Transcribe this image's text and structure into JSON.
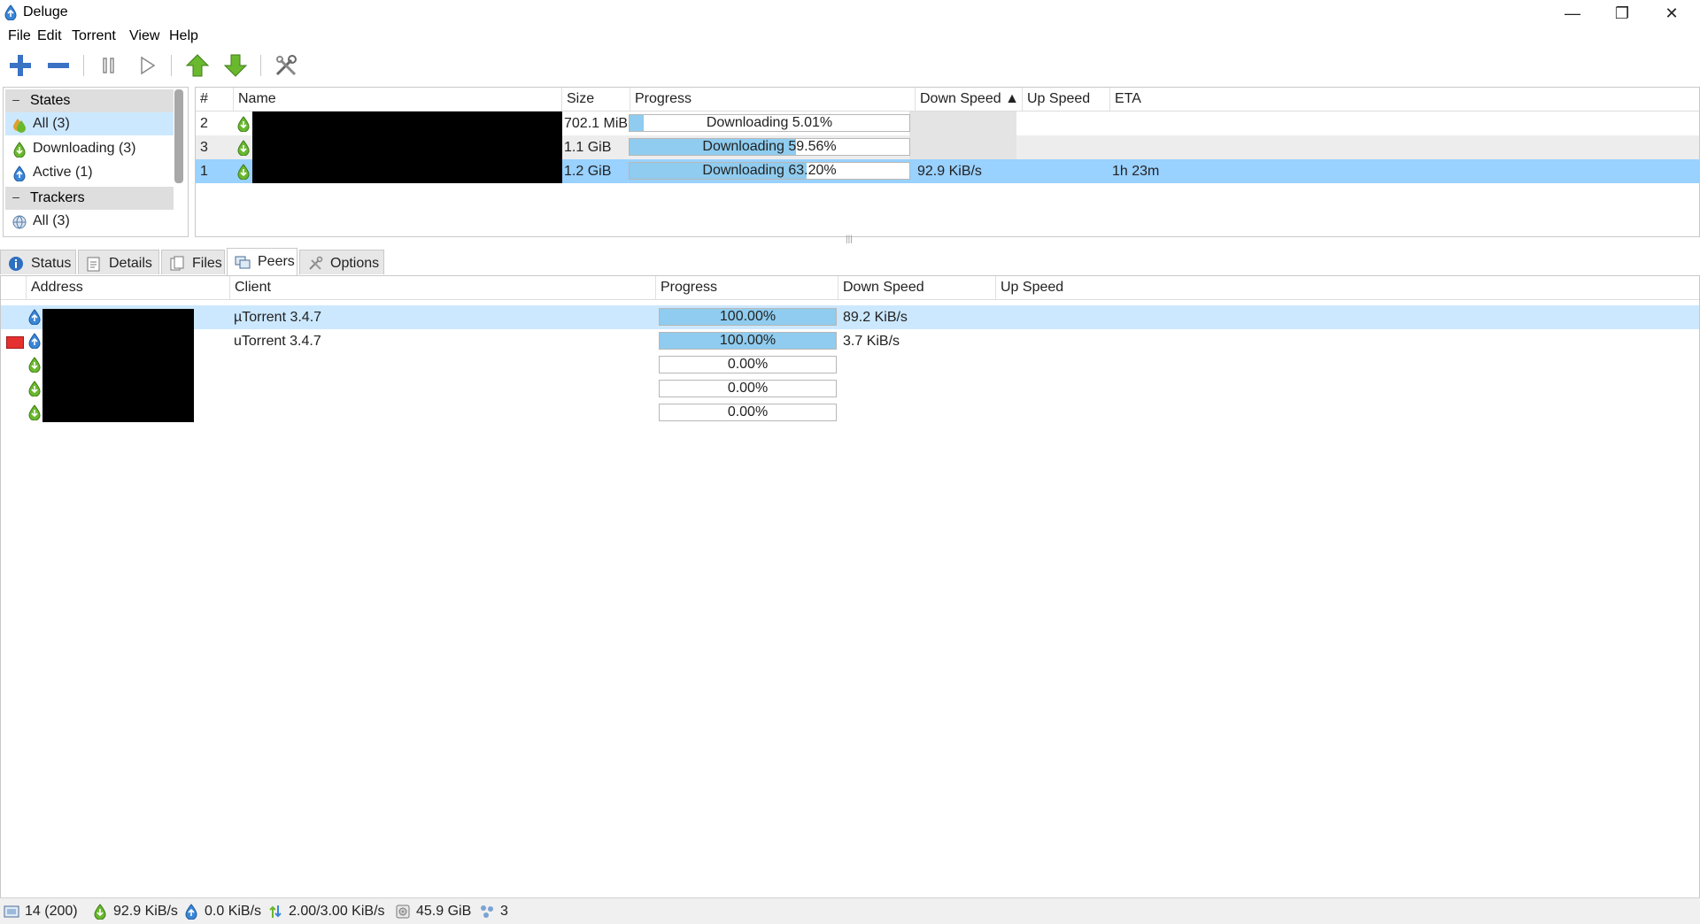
{
  "window": {
    "title": "Deluge"
  },
  "menu": [
    "File",
    "Edit",
    "Torrent",
    "View",
    "Help"
  ],
  "sidebar": {
    "states_label": "States",
    "state_items": [
      "All (3)",
      "Downloading (3)",
      "Active (1)"
    ],
    "trackers_label": "Trackers",
    "tracker_items": [
      "All (3)"
    ]
  },
  "torrent_list": {
    "columns": [
      "#",
      "Name",
      "Size",
      "Progress",
      "Down Speed ▲",
      "Up Speed",
      "ETA"
    ],
    "rows": [
      {
        "num": "2",
        "size": "702.1 MiB",
        "progress_text": "Downloading 5.01%",
        "progress": 0.0501,
        "down": "",
        "up": "",
        "eta": ""
      },
      {
        "num": "3",
        "size": "1.1 GiB",
        "progress_text": "Downloading 59.56%",
        "progress": 0.5956,
        "down": "",
        "up": "",
        "eta": ""
      },
      {
        "num": "1",
        "size": "1.2 GiB",
        "progress_text": "Downloading 63.20%",
        "progress": 0.632,
        "down": "92.9 KiB/s",
        "up": "",
        "eta": "1h 23m"
      }
    ]
  },
  "tabs": [
    "Status",
    "Details",
    "Files",
    "Peers",
    "Options"
  ],
  "peers": {
    "columns": [
      "Address",
      "Client",
      "Progress",
      "Down Speed",
      "Up Speed"
    ],
    "rows": [
      {
        "client": "µTorrent 3.4.7",
        "progress_text": "100.00%",
        "progress": 1.0,
        "down": "89.2 KiB/s",
        "up": ""
      },
      {
        "client": "uTorrent 3.4.7",
        "progress_text": "100.00%",
        "progress": 1.0,
        "down": "3.7 KiB/s",
        "up": ""
      },
      {
        "client": "",
        "progress_text": "0.00%",
        "progress": 0.0,
        "down": "",
        "up": ""
      },
      {
        "client": "",
        "progress_text": "0.00%",
        "progress": 0.0,
        "down": "",
        "up": ""
      },
      {
        "client": "",
        "progress_text": "0.00%",
        "progress": 0.0,
        "down": "",
        "up": ""
      }
    ]
  },
  "statusbar": {
    "connections": "14 (200)",
    "download": "92.9 KiB/s",
    "upload": "0.0 KiB/s",
    "protocol": "2.00/3.00 KiB/s",
    "free_space": "45.9 GiB",
    "dht": "3"
  },
  "colors": {
    "selection": "#99d1ff",
    "selection_light": "#cce8ff",
    "progress_fill": "#8fccef",
    "green": "#6ab82e",
    "blue": "#2f7fd1"
  }
}
